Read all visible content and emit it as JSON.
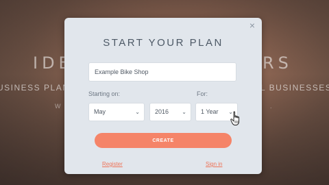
{
  "background": {
    "title_left": "IDE",
    "title_right": "RS",
    "subtitle_left": "USINESS PLAN",
    "subtitle_right": "L BUSINESSES",
    "small_left": "W",
    "small_right": "."
  },
  "modal": {
    "title": "START YOUR PLAN",
    "close_glyph": "×",
    "business_name_value": "Example Bike Shop",
    "starting_label": "Starting on:",
    "for_label": "For:",
    "month_value": "May",
    "year_value": "2016",
    "duration_value": "1 Year",
    "chevron_glyph": "⌄",
    "create_label": "CREATE",
    "register_label": "Register",
    "signin_label": "Sign in"
  },
  "colors": {
    "accent": "#f58468",
    "modal_bg": "#e1e6ec",
    "link": "#ee7257"
  },
  "icons": {
    "close": "close-icon",
    "chevron": "chevron-down-icon",
    "cursor": "hand-pointer-icon"
  }
}
